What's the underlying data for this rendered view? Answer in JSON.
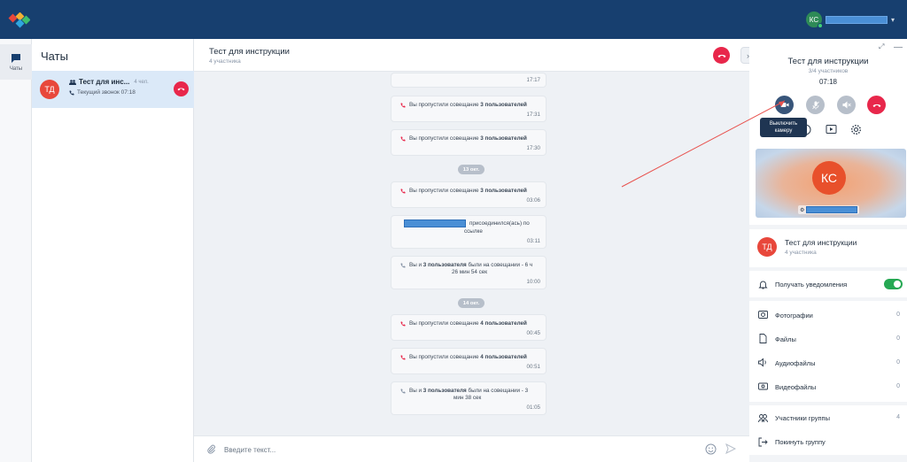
{
  "left_nav": {
    "chats_label": "Чаты"
  },
  "chats_panel": {
    "title": "Чаты",
    "items": [
      {
        "avatar": "ТД",
        "name": "Тест для инс...",
        "count": "4 чел.",
        "status": "Текущий звонок 07:18"
      }
    ]
  },
  "user": {
    "initials": "КС"
  },
  "conversation": {
    "title": "Тест для инструкции",
    "subtitle": "4 участника",
    "messages": [
      {
        "kind": "time_only",
        "time": "17:17"
      },
      {
        "kind": "missed",
        "text_before": "Вы пропустили совещание ",
        "bold": "3 пользователей",
        "time": "17:31"
      },
      {
        "kind": "missed",
        "text_before": "Вы пропустили совещание ",
        "bold": "3 пользователей",
        "time": "17:30"
      },
      {
        "kind": "date",
        "label": "13 окт."
      },
      {
        "kind": "missed",
        "text_before": "Вы пропустили совещание ",
        "bold": "3 пользователей",
        "time": "03:06"
      },
      {
        "kind": "joined",
        "line1": "присоединился(ась) по",
        "line2": "ссылке",
        "time": "03:11"
      },
      {
        "kind": "was_in",
        "text_before": "Вы и ",
        "bold": "3 пользователя",
        "line1_after": " были на совещании - 6 ч",
        "line2": "26 мин 54 сек",
        "time": "10:00"
      },
      {
        "kind": "date",
        "label": "14 окт."
      },
      {
        "kind": "missed",
        "text_before": "Вы пропустили совещание ",
        "bold": "4 пользователей",
        "time": "00:45"
      },
      {
        "kind": "missed",
        "text_before": "Вы пропустили совещание ",
        "bold": "4 пользователей",
        "time": "00:51"
      },
      {
        "kind": "was_in",
        "text_before": "Вы и ",
        "bold": "3 пользователя",
        "line1_after": " были на совещании - 3",
        "line2": "мин 38 сек",
        "time": "01:05"
      }
    ],
    "composer_placeholder": "Введите текст..."
  },
  "call": {
    "title": "Тест для инструкции",
    "participants": "3/4 участников",
    "timer": "07:18",
    "tooltip_line1": "Выключить",
    "tooltip_line2": "камеру",
    "tile_initials": "КС"
  },
  "info": {
    "avatar": "ТД",
    "title": "Тест для инструкции",
    "subtitle": "4 участника"
  },
  "settings": {
    "notifications_label": "Получать уведомления",
    "notifications_on": true
  },
  "media": [
    {
      "icon": "photo-icon",
      "label": "Фотографии",
      "count": "0"
    },
    {
      "icon": "file-icon",
      "label": "Файлы",
      "count": "0"
    },
    {
      "icon": "audio-icon",
      "label": "Аудиофайлы",
      "count": "0"
    },
    {
      "icon": "video-icon",
      "label": "Видеофайлы",
      "count": "0"
    }
  ],
  "group": {
    "members_label": "Участники группы",
    "members_count": "4",
    "leave_label": "Покинуть группу"
  },
  "colors": {
    "topbar": "#173f6f",
    "accent_red": "#e8274b",
    "selected_chat": "#dbe9f8",
    "toggle_on": "#26a853",
    "redaction": "#4a8fd6"
  }
}
